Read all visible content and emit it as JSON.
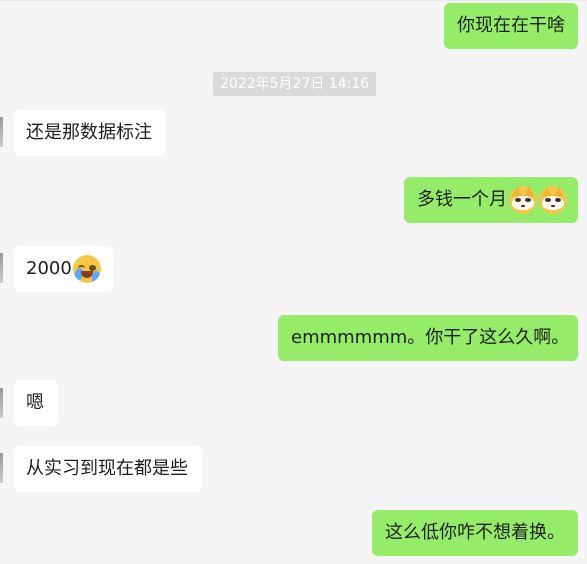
{
  "chat": {
    "timestamp": "2022年5月27日 14:16",
    "messages": [
      {
        "sender": "self",
        "text": "你现在在干啥"
      },
      {
        "sender": "other",
        "text": "还是那数据标注"
      },
      {
        "sender": "self",
        "text": "多钱一个月",
        "emojis": [
          "shiba-face-emoji",
          "shiba-face-emoji"
        ]
      },
      {
        "sender": "other",
        "text": "2000",
        "emojis": [
          "crying-face-emoji"
        ]
      },
      {
        "sender": "self",
        "text": "emmmmmm。你干了这么久啊。"
      },
      {
        "sender": "other",
        "text": "嗯"
      },
      {
        "sender": "other",
        "text": "从实习到现在都是些"
      },
      {
        "sender": "self",
        "text": "这么低你咋不想着换。"
      }
    ]
  },
  "colors": {
    "background": "#f5f5f5",
    "incoming_bubble": "#ffffff",
    "outgoing_bubble": "#95ec69",
    "timestamp_bg": "#dadada",
    "timestamp_text": "#ffffff"
  }
}
